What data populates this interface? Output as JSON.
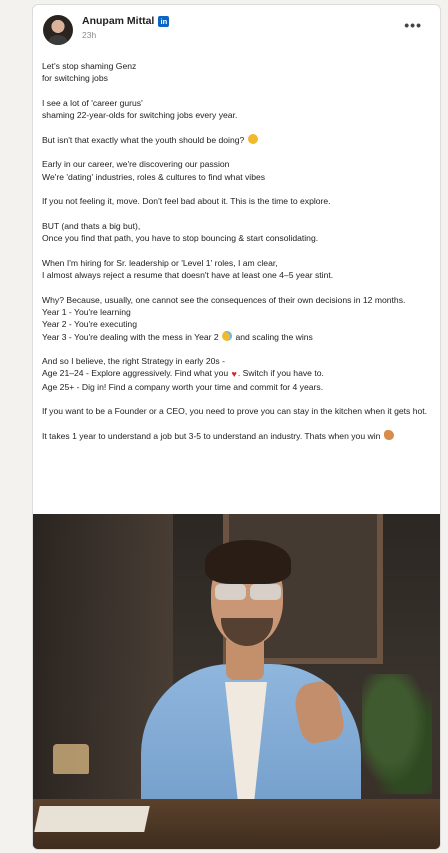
{
  "post": {
    "author": "Anupam Mittal",
    "badge": "in",
    "time": "23h",
    "more_label": "•••",
    "paragraphs": [
      [
        "Let's stop shaming Genz",
        "for switching jobs"
      ],
      [
        "I see a lot of 'career gurus'",
        "shaming 22-year-olds for switching jobs every year."
      ],
      [
        "But isn't that exactly what the youth should be doing?"
      ],
      [
        "Early in our career, we're discovering our passion",
        "We're 'dating' industries, roles & cultures to find what vibes"
      ],
      [
        "If you not feeling it, move. Don't feel bad about it. This is the time to explore."
      ],
      [
        "BUT (and thats a big but),",
        "Once you find that path, you have to stop bouncing & start consolidating."
      ],
      [
        "When I'm hiring for Sr. leadership or 'Level 1' roles, I am clear,",
        "I almost always reject a resume that doesn't have at least one 4–5 year stint."
      ],
      [
        "Why? Because, usually, one cannot see the consequences of their own decisions in 12 months.",
        "Year 1 - You're learning",
        "Year 2 - You're executing"
      ],
      [
        "And so I believe, the right Strategy in early 20s -"
      ],
      [
        "If you want to be a Founder or a CEO, you need to prove you can stay in the kitchen when it gets hot."
      ]
    ],
    "year3_a": "Year 3 - You're dealing with the mess in Year 2",
    "year3_b": "and scaling the wins",
    "age21_a": "Age 21–24 - Explore aggressively. Find what you",
    "age21_b": ". Switch if you have to.",
    "age25": "Age 25+ - Dig in! Find a company worth your time and commit for 4 years.",
    "closing": "It takes 1 year to understand a job but 3-5 to understand an industry. Thats when you win",
    "heart": "♥"
  },
  "colors": {
    "linkedin_blue": "#0a66c2",
    "background": "#f3f2ef",
    "card": "#ffffff"
  },
  "icons": [
    "linkedin-badge-icon",
    "more-options-icon",
    "thinking-face-icon",
    "sweat-smile-icon",
    "heart-icon",
    "flexed-biceps-icon"
  ]
}
